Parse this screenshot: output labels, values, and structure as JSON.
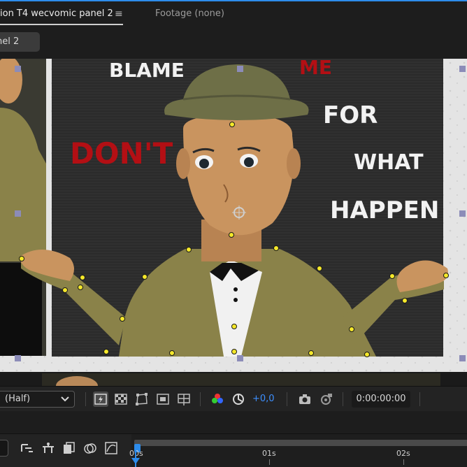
{
  "panel_tabs": {
    "active_label": "ion T4 wecvomic panel 2",
    "menu_icon": "≡",
    "footage_label": "Footage (none)"
  },
  "sub_tab": {
    "label": "nel 2"
  },
  "artwork": {
    "words": [
      "BLAME",
      "ME",
      "DON'T",
      "FOR",
      "WHAT",
      "HAPPEN"
    ],
    "colors": {
      "white_text": "#f2f2f2",
      "red_text": "#b30f14",
      "skin": "#c9945f",
      "coat": "#8a8249",
      "hat": "#6e6f47",
      "background": "#2a2a2a"
    }
  },
  "viewer_toolbar": {
    "resolution": "(Half)",
    "exposure": "+0,0",
    "timecode": "0:00:00:00",
    "icons": [
      "fast-preview-icon",
      "transparency-grid-icon",
      "mask-path-icon",
      "region-of-interest-icon",
      "grid-guides-icon",
      "color-channel-icon",
      "reset-exposure-icon",
      "snapshot-icon",
      "show-snapshot-icon"
    ]
  },
  "timeline": {
    "ruler_labels": [
      "00s",
      "01s",
      "02s"
    ],
    "icons": [
      "comp-marker-icon",
      "draft-3d-icon",
      "frame-blending-icon",
      "motion-blur-icon",
      "graph-editor-icon"
    ],
    "accent": "#2d8ceb"
  }
}
